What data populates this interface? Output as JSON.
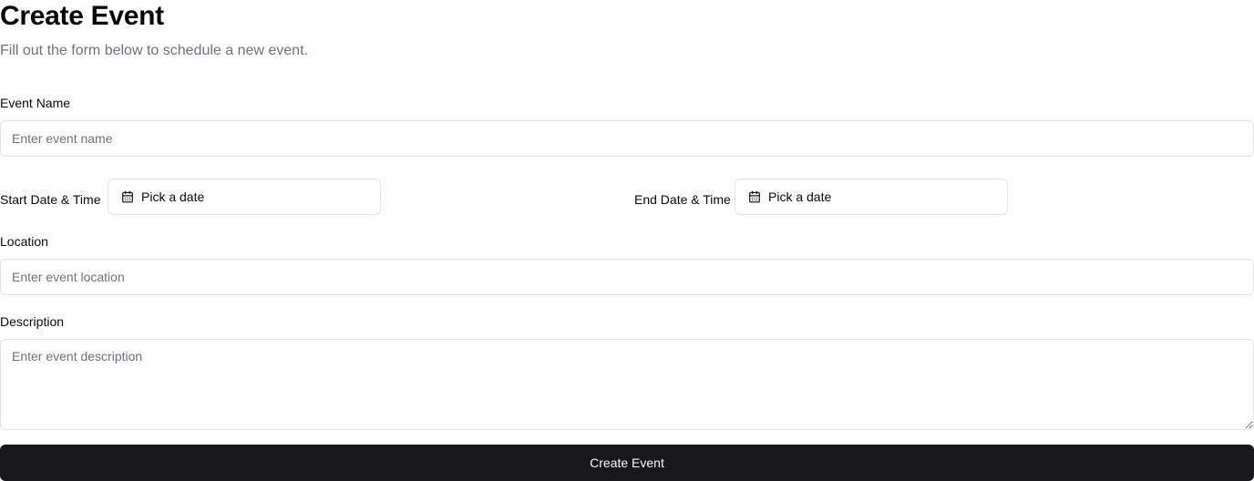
{
  "header": {
    "title": "Create Event",
    "subtitle": "Fill out the form below to schedule a new event."
  },
  "form": {
    "event_name": {
      "label": "Event Name",
      "placeholder": "Enter event name",
      "value": ""
    },
    "start_date": {
      "label": "Start Date & Time",
      "button_text": "Pick a date",
      "icon": "calendar-icon"
    },
    "end_date": {
      "label": "End Date & Time",
      "button_text": "Pick a date",
      "icon": "calendar-icon"
    },
    "location": {
      "label": "Location",
      "placeholder": "Enter event location",
      "value": ""
    },
    "description": {
      "label": "Description",
      "placeholder": "Enter event description",
      "value": ""
    },
    "submit_label": "Create Event"
  },
  "colors": {
    "primary_button": "#18181b",
    "border": "#e4e4e7",
    "muted_text": "#71717a"
  }
}
